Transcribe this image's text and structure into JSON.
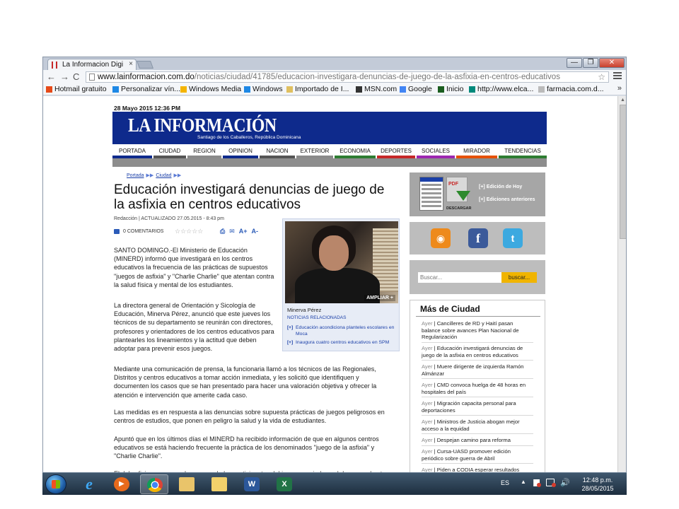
{
  "browser": {
    "tab_title": "La Informacion Digi",
    "tab_close": "×",
    "window_min": "—",
    "window_max": "❐",
    "window_close": "✕",
    "url_host": "www.lainformacion.com.do",
    "url_path": "/noticias/ciudad/41785/educacion-investigara-denuncias-de-juego-de-la-asfixia-en-centros-educativos",
    "star": "☆",
    "nav_back": "←",
    "nav_forward": "→",
    "nav_reload": "C",
    "bookmarks": [
      {
        "label": "Hotmail gratuito",
        "color": "#e64a19"
      },
      {
        "label": "Personalizar vín...",
        "color": "#1e88e5"
      },
      {
        "label": "Windows Media",
        "color": "#f4b400"
      },
      {
        "label": "Windows",
        "color": "#1e88e5"
      },
      {
        "label": "Importado de I...",
        "color": "#e0c060"
      },
      {
        "label": "MSN.com",
        "color": "#333333"
      },
      {
        "label": "Google",
        "color": "#4285f4"
      },
      {
        "label": "Inicio",
        "color": "#1b5e20"
      },
      {
        "label": "http://www.elca...",
        "color": "#00897b"
      },
      {
        "label": "farmacia.com.d...",
        "color": "#bbbbbb"
      }
    ],
    "bookmarks_more": "»"
  },
  "site": {
    "date": "28 Mayo 2015 12:36 PM",
    "logo": "LA INFORMACIÓN",
    "logo_sub": "Santiago de los Caballeros, República Dominicana",
    "brand_color": "#0e2a8c",
    "nav": [
      {
        "label": "PORTADA",
        "color": "#0e2a8c"
      },
      {
        "label": "CIUDAD",
        "color": "#555555"
      },
      {
        "label": "REGION",
        "color": "#8a8a8a"
      },
      {
        "label": "OPINION",
        "color": "#0e2a8c"
      },
      {
        "label": "NACION",
        "color": "#555555"
      },
      {
        "label": "EXTERIOR",
        "color": "#8a8a8a"
      },
      {
        "label": "ECONOMIA",
        "color": "#2e7d32"
      },
      {
        "label": "DEPORTES",
        "color": "#c62828"
      },
      {
        "label": "SOCIALES",
        "color": "#9c27b0"
      },
      {
        "label": "MIRADOR",
        "color": "#e65100"
      },
      {
        "label": "TENDENCIAS",
        "color": "#2e7d32"
      }
    ]
  },
  "article": {
    "breadcrumb": [
      "Portada",
      "Ciudad"
    ],
    "breadcrumb_arrow": "▶▶",
    "headline": "Educación investigará denuncias de juego de la asfixia en centros educativos",
    "byline": "Redacción | ACTUALIZADO 27.05.2015 - 8:43 pm",
    "comments": "0 COMENTARIOS",
    "stars": "☆☆☆☆☆",
    "tool_print": "⎙",
    "tool_email": "✉",
    "tool_font_up": "A+",
    "tool_font_down": "A-",
    "paragraphs": [
      "SANTO DOMINGO.-El Ministerio de Educación (MINERD) informó que investigará en los centros educativos la frecuencia de las prácticas de supuestos \"juegos de asfixia\" y \"Charlie Charlie\" que atentan contra la salud física y mental de los estudiantes.",
      "La directora general de Orientación y Sicología de Educación, Minerva Pérez, anunció que este jueves los técnicos de su departamento se reunirán con directores, profesores y orientadores de los centros educativos para plantearles los lineamientos y la actitud que deben adoptar para prevenir esos juegos.",
      "Mediante una comunicación de prensa, la funcionaria llamó a los técnicos de las Regionales, Distritos y centros educativos a tomar acción inmediata, y les solicitó que identifiquen y documenten los casos que se han presentado para hacer una valoración objetiva y ofrecer la atención e intervención que amerite cada caso.",
      "Las medidas es en respuesta a las denuncias sobre supuesta prácticas de juegos peligrosos en centros de estudios, que ponen en peligro la salud y la vida de estudiantes.",
      "Apuntó que en los últimos días el MINERD ha recibido información de que en algunos centros educativos se está haciendo frecuente la práctica de los denominados \"juego de la asfixia\" y \"Charlie Charlie\".",
      "El del asfixia es provocado por uno de los participantes del juego, que induce el desmayo de otro"
    ],
    "photo_caption": "Minerva Pérez",
    "photo_ampliar": "AMPLIAR +",
    "related_title": "NOTICIAS RELACIONADAS",
    "related_marker": "[+]",
    "related": [
      "Educación acondiciona planteles escolares en Moca",
      "Inaugura cuatro centros educativos en SPM"
    ]
  },
  "sidebar": {
    "pdf_label": "PDF",
    "download_label": "DESCARGAR",
    "edition_today": "[+] Edición de Hoy",
    "edition_previous": "[+] Ediciones anteriores",
    "rss": "◉",
    "facebook": "f",
    "twitter": "t",
    "search_placeholder": "Buscar...",
    "search_button": "buscar...",
    "search_button_color": "#f0b400",
    "more_title": "Más de Ciudad",
    "news": [
      {
        "when": "Ayer",
        "text": "Cancilleres de RD y Haití pasan balance sobre avances Plan Nacional de Regularización"
      },
      {
        "when": "Ayer",
        "text": "Educación investigará denuncias de juego de la asfixia en centros educativos"
      },
      {
        "when": "Ayer",
        "text": "Muere dirigente de izquierda Ramón Almánzar"
      },
      {
        "when": "Ayer",
        "text": "CMD convoca huelga de 48 horas en hospitales del país"
      },
      {
        "when": "Ayer",
        "text": "Migración capacita personal para deportaciones"
      },
      {
        "when": "Ayer",
        "text": "Ministros de Justicia abogan mejor acceso a la equidad"
      },
      {
        "when": "Ayer",
        "text": "Despejan camino para reforma"
      },
      {
        "when": "Ayer",
        "text": "Cursa-UASD promover edición periódico sobre guerra de Abril"
      },
      {
        "when": "Ayer",
        "text": "Piden a CODIA esperar resultados"
      }
    ]
  },
  "taskbar": {
    "word_glyph": "W",
    "excel_glyph": "X",
    "ie_glyph": "e",
    "media_glyph": "▶",
    "language": "ES",
    "tray_arrow": "▲",
    "volume": "🔊",
    "time": "12:48 p.m.",
    "date": "28/05/2015"
  }
}
